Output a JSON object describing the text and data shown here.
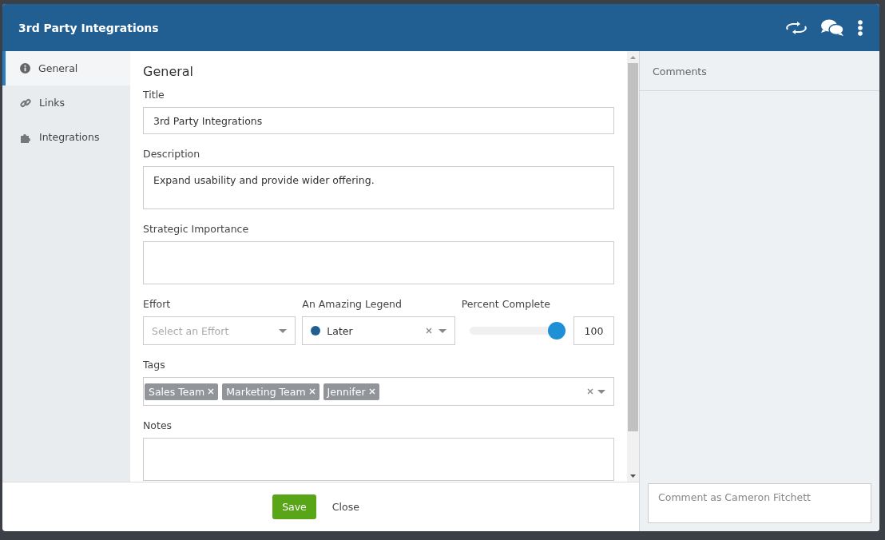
{
  "window": {
    "title": "3rd Party Integrations"
  },
  "sidebar": {
    "items": [
      {
        "label": "General",
        "selected": true
      },
      {
        "label": "Links",
        "selected": false
      },
      {
        "label": "Integrations",
        "selected": false
      }
    ]
  },
  "form": {
    "heading": "General",
    "fields": [
      {
        "kind": "text",
        "label": "Title",
        "value": "3rd Party Integrations"
      },
      {
        "kind": "textarea",
        "label": "Description",
        "value": "Expand usability and provide wider offering."
      },
      {
        "kind": "textarea",
        "label": "Strategic Importance"
      },
      {
        "kind": "row",
        "fields": [
          {
            "kind": "select",
            "label": "Effort",
            "placeholder": "Select an Effort"
          },
          {
            "kind": "select",
            "label": "An Amazing Legend",
            "value": "Later",
            "color": "#215f93"
          },
          {
            "kind": "slider",
            "label": "Percent Complete",
            "level": 1,
            "value": "100"
          }
        ]
      },
      {
        "kind": "tags",
        "label": "Tags",
        "tags": [
          "Sales Team",
          "Marketing Team",
          "Jennifer"
        ]
      },
      {
        "kind": "textarea",
        "label": "Notes"
      }
    ]
  },
  "footer": {
    "buttons": [
      {
        "label": "Save",
        "kind": "primary"
      },
      {
        "label": "Close",
        "kind": "plain"
      }
    ]
  },
  "comments": {
    "title": "Comments",
    "placeholder": "Comment as Cameron Fitchett"
  }
}
